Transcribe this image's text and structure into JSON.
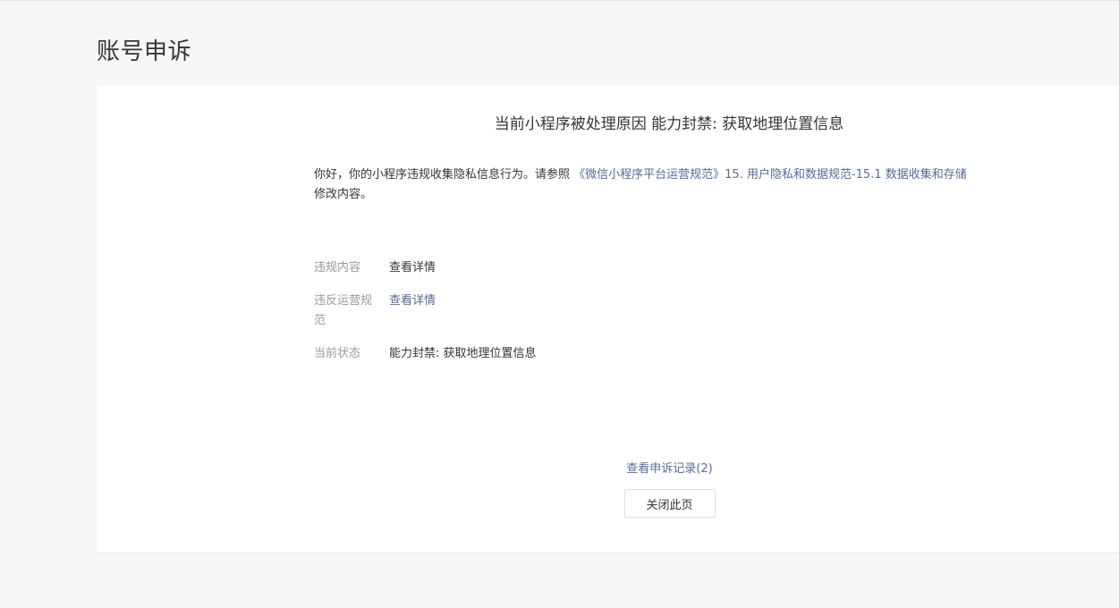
{
  "page": {
    "title": "账号申诉"
  },
  "card": {
    "reason_title": "当前小程序被处理原因 能力封禁: 获取地理位置信息",
    "notice": {
      "text_before": "你好，你的小程序违规收集隐私信息行为。请参照 ",
      "link_text": "《微信小程序平台运营规范》15. 用户隐私和数据规范-15.1 数据收集和存储",
      "text_after": "修改内容。"
    },
    "rows": [
      {
        "label": "违规内容",
        "value": "查看详情"
      },
      {
        "label": "违反运营规范",
        "value": "查看详情"
      },
      {
        "label": "当前状态",
        "value": "能力封禁: 获取地理位置信息"
      }
    ],
    "footer": {
      "record_link": "查看申诉记录(2)",
      "close_button": "关闭此页"
    }
  },
  "colors": {
    "link": "#576b95",
    "background": "#f6f7f9",
    "card": "#ffffff"
  }
}
